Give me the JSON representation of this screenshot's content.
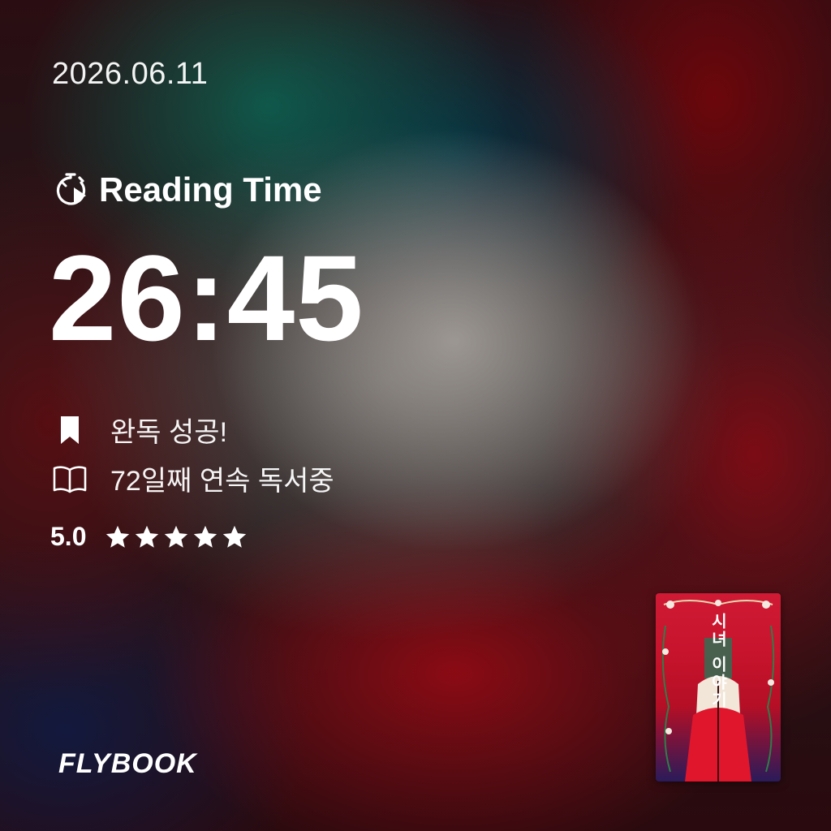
{
  "date": "2026.06.11",
  "reading": {
    "label": "Reading Time",
    "icon": "stopwatch-play-icon",
    "time": "26:45"
  },
  "status": {
    "completed": {
      "icon": "bookmark-icon",
      "text": "완독 성공!"
    },
    "streak": {
      "icon": "open-book-icon",
      "text": "72일째 연속 독서중"
    }
  },
  "rating": {
    "value": "5.0",
    "stars": 5,
    "max_stars": 5,
    "star_color": "#ffffff"
  },
  "brand": {
    "logo_text": "FLYBOOK"
  },
  "book": {
    "cover_title": "시녀 이야기",
    "cover_colors": [
      "#d01a35",
      "#2a1b5a",
      "#f2e6d8"
    ]
  }
}
